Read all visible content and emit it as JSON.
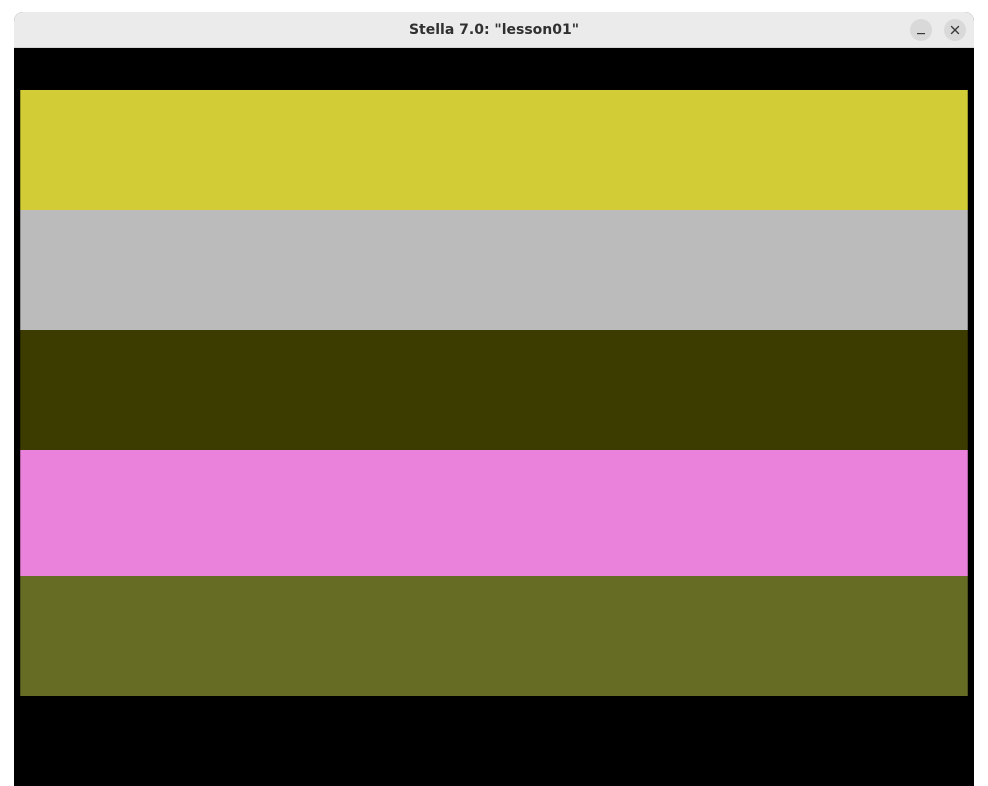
{
  "window": {
    "title": "Stella 7.0: \"lesson01\""
  },
  "titlebar_buttons": {
    "minimize_icon": "minimize-icon",
    "close_icon": "close-icon"
  },
  "screen": {
    "background": "#000000",
    "bands": [
      {
        "color": "#d2cc36"
      },
      {
        "color": "#bbbbbb"
      },
      {
        "color": "#3c3b00"
      },
      {
        "color": "#ea82db"
      },
      {
        "color": "#676c24"
      }
    ]
  }
}
